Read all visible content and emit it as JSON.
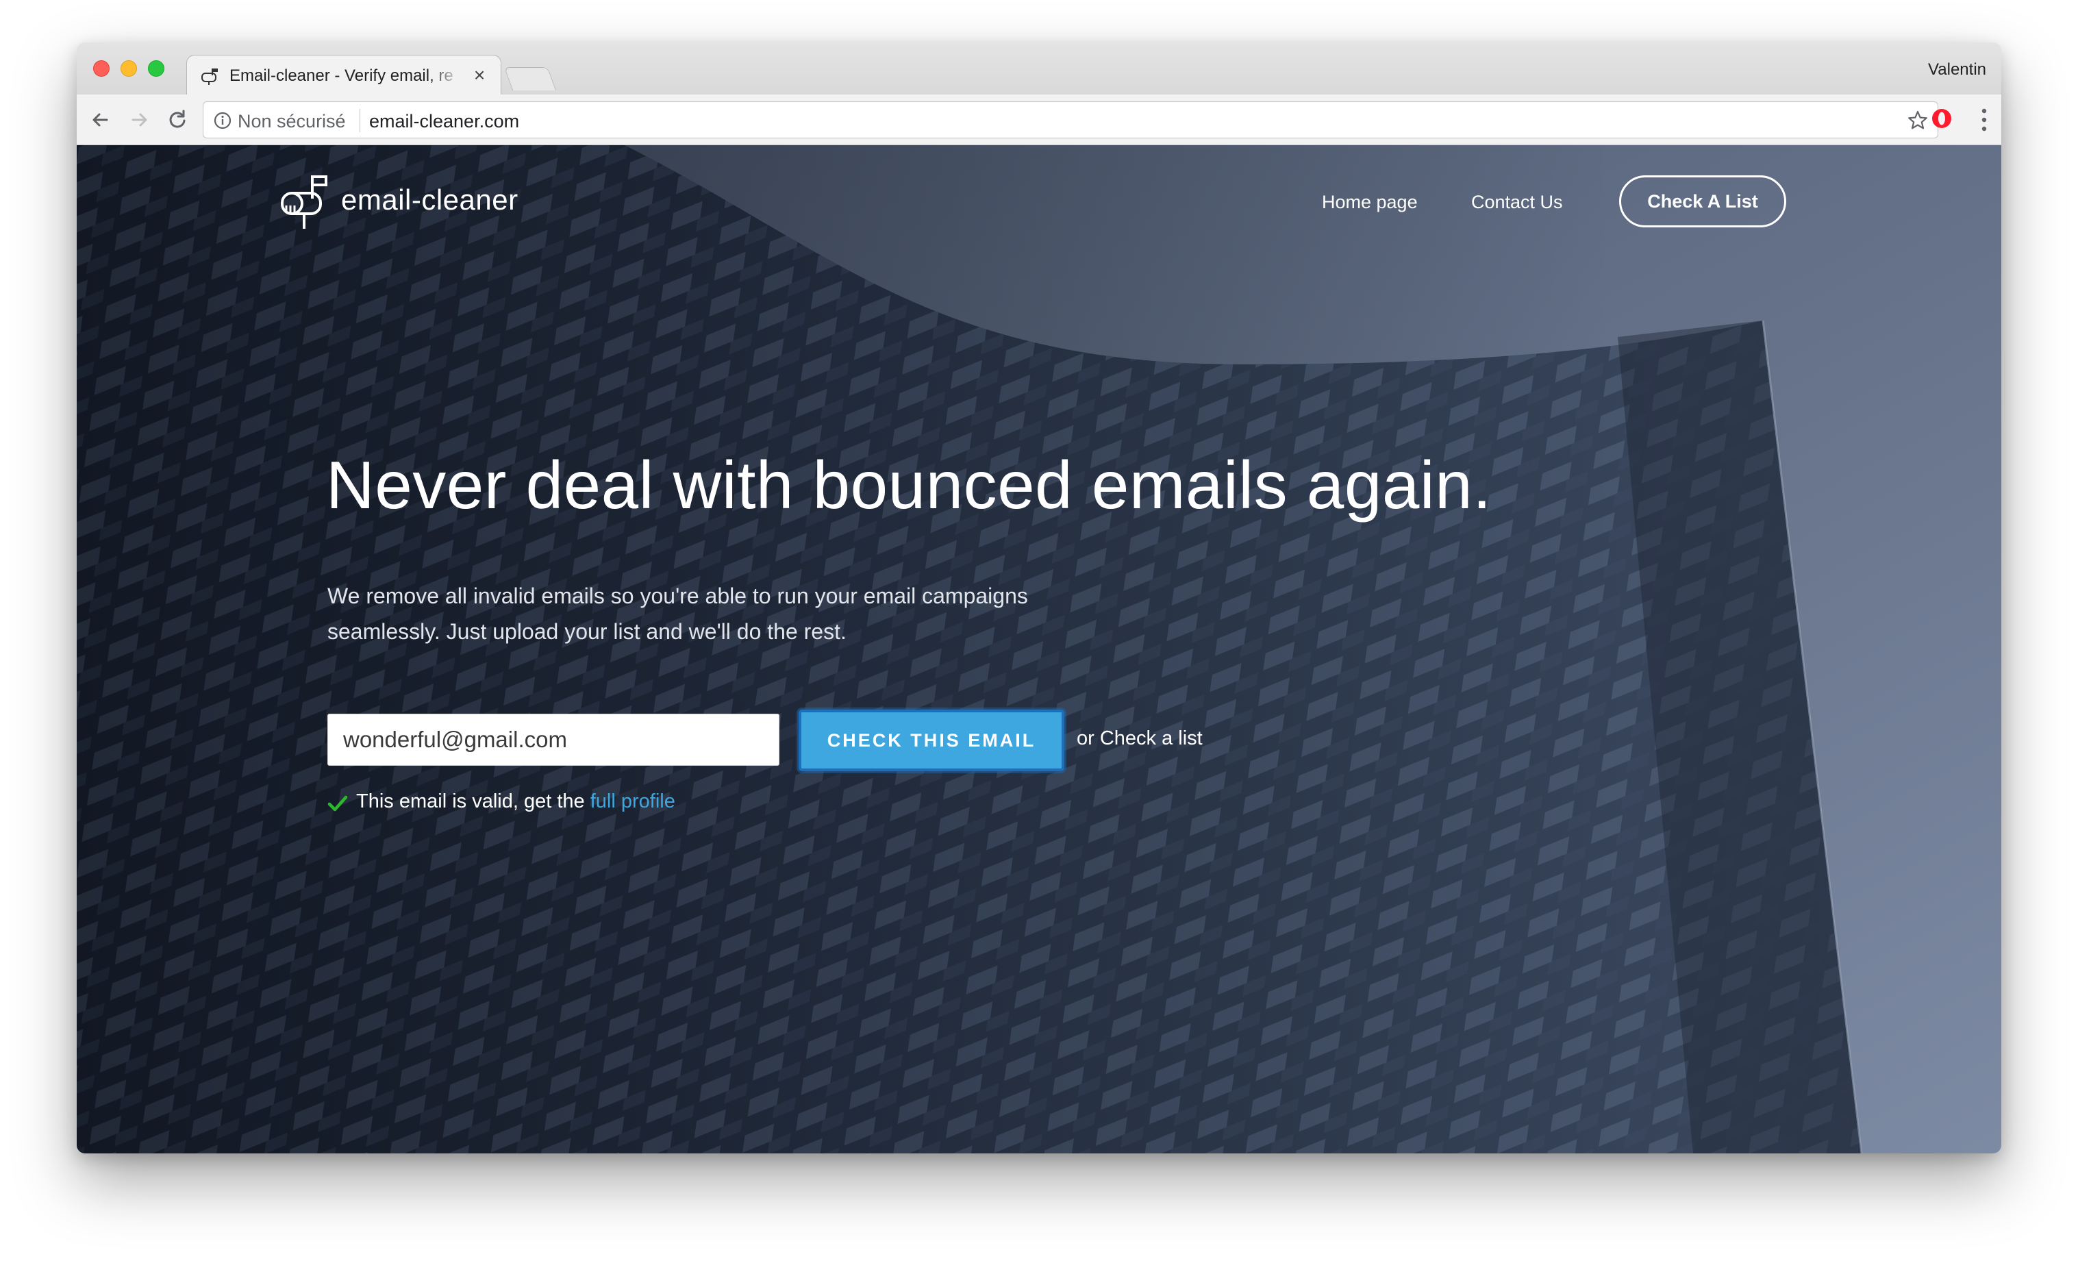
{
  "browser": {
    "tab_title": "Email-cleaner - Verify email, re",
    "tab_close": "×",
    "profile_name": "Valentin",
    "security_label": "Non sécurisé",
    "url": "email-cleaner.com",
    "icons": [
      "back-arrow-icon",
      "forward-arrow-icon",
      "reload-icon",
      "info-icon",
      "star-icon",
      "opera-icon",
      "menu-dots-icon"
    ]
  },
  "site": {
    "logo_text": "email-cleaner",
    "nav": {
      "home": "Home page",
      "contact": "Contact Us",
      "check_list": "Check A List"
    },
    "hero": {
      "title": "Never deal with bounced emails again.",
      "subtitle": "We remove all invalid emails so you're able to run your email campaigns seamlessly. Just upload your list and we'll do the rest."
    },
    "form": {
      "email_value": "wonderful@gmail.com",
      "button_label": "CHECK THIS EMAIL",
      "alt_link": "or Check a list",
      "valid_message": "This email is valid, get the",
      "valid_link": "full profile"
    }
  },
  "colors": {
    "accent": "#3fa7e0",
    "accent_border": "#1c6fb8",
    "valid_check": "#2eb82e"
  }
}
